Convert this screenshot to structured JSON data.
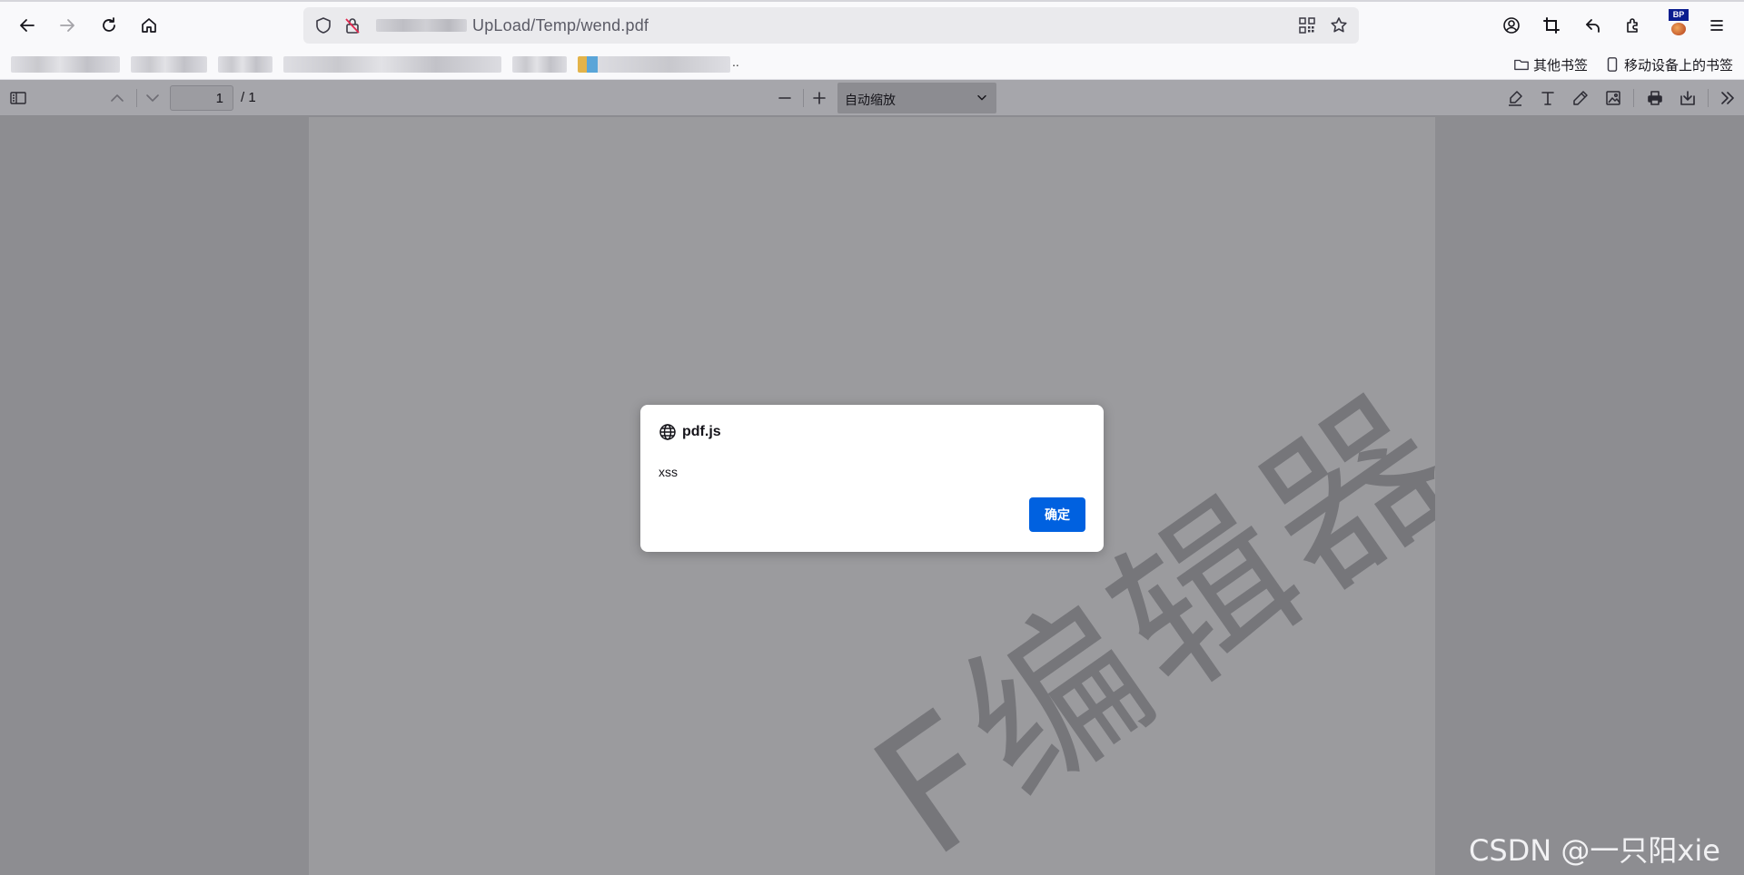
{
  "browser": {
    "url_text": "UpLoad/Temp/wend.pdf",
    "bookmarks": {
      "dots": "..",
      "other_bookmarks": "其他书签",
      "mobile_bookmarks": "移动设备上的书签"
    },
    "extension_badge": "BP"
  },
  "pdf_toolbar": {
    "page_number": "1",
    "page_total": "/ 1",
    "zoom_selected": "自动缩放"
  },
  "document": {
    "watermark": "F编辑器"
  },
  "dialog": {
    "title": "pdf.js",
    "message": "xss",
    "ok_label": "确定"
  },
  "overlay": {
    "watermark_text": "CSDN @一只阳xie"
  }
}
